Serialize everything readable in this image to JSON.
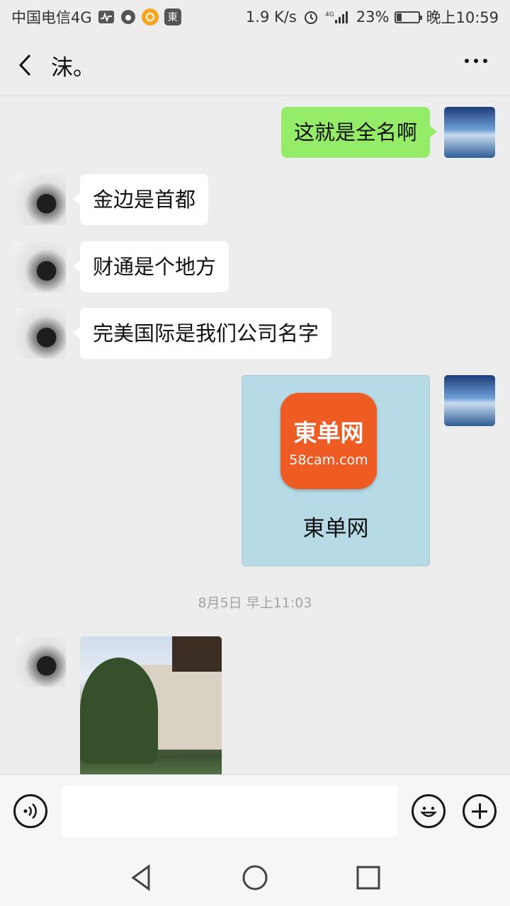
{
  "status_bar": {
    "carrier": "中国电信4G",
    "speed": "1.9 K/s",
    "network": "4G",
    "battery_percent": "23%",
    "battery_level": 0.23,
    "time": "晚上10:59",
    "badge_app": "東"
  },
  "header": {
    "title": "沫。"
  },
  "messages": [
    {
      "from": "me",
      "type": "text",
      "text": "这就是全名啊"
    },
    {
      "from": "other",
      "type": "text",
      "text": "金边是首都"
    },
    {
      "from": "other",
      "type": "text",
      "text": "财通是个地方"
    },
    {
      "from": "other",
      "type": "text",
      "text": "完美国际是我们公司名字"
    },
    {
      "from": "me",
      "type": "image",
      "logo_line1": "東单网",
      "logo_line2": "58cam.com",
      "caption": "東单网"
    }
  ],
  "timestamp": "8月5日 早上11:03",
  "input": {
    "value": "",
    "placeholder": ""
  },
  "colors": {
    "background": "#ededed",
    "bubble_me": "#95ec69",
    "bubble_other": "#ffffff",
    "logo_orange": "#ee5b23"
  },
  "icons": [
    "back-arrow-icon",
    "more-icon",
    "voice-icon",
    "emoji-icon",
    "plus-icon",
    "nav-back-icon",
    "nav-home-icon",
    "nav-recent-icon"
  ]
}
